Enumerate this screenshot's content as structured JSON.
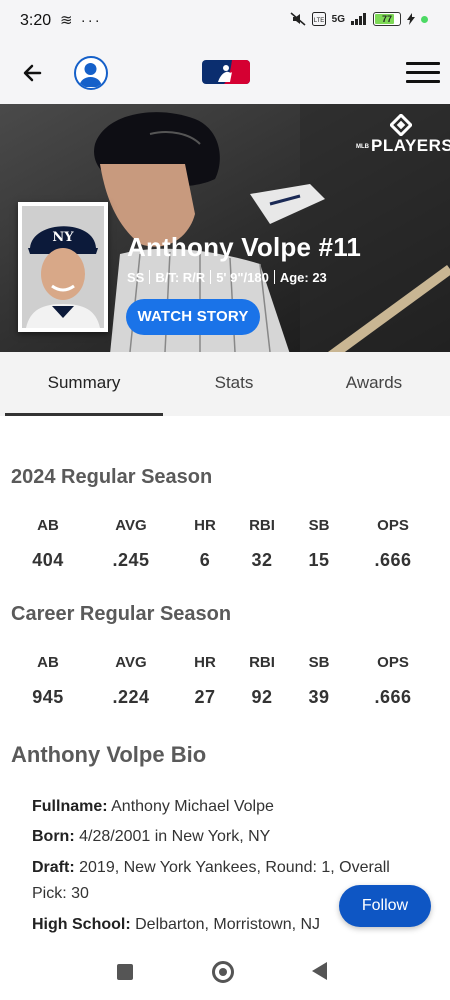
{
  "status_bar": {
    "time": "3:20",
    "left_icons": "≋ ···",
    "network": "5G",
    "battery": "77",
    "battery_color": "#7ed957"
  },
  "header": {
    "back_icon": "arrow-left-icon",
    "profile_icon": "user-circle-icon",
    "logo": "mlb-logo",
    "menu_icon": "hamburger-menu-icon"
  },
  "hero": {
    "players_brand_small": "MLB",
    "players_brand": "PLAYERS",
    "name": "Anthony Volpe #11",
    "position": "SS",
    "bats_throws": "B/T: R/R",
    "height_weight": "5' 9\"/180",
    "age": "Age: 23",
    "watch_button": "WATCH STORY",
    "accent": "#1a73e8"
  },
  "tabs": [
    {
      "label": "Summary",
      "active": true
    },
    {
      "label": "Stats",
      "active": false
    },
    {
      "label": "Awards",
      "active": false
    }
  ],
  "season_2024": {
    "title": "2024 Regular Season",
    "headers": [
      "AB",
      "AVG",
      "HR",
      "RBI",
      "SB",
      "OPS"
    ],
    "values": [
      "404",
      ".245",
      "6",
      "32",
      "15",
      ".666"
    ]
  },
  "career": {
    "title": "Career Regular Season",
    "headers": [
      "AB",
      "AVG",
      "HR",
      "RBI",
      "SB",
      "OPS"
    ],
    "values": [
      "945",
      ".224",
      "27",
      "92",
      "39",
      ".666"
    ]
  },
  "bio": {
    "title": "Anthony Volpe Bio",
    "fullname_label": "Fullname:",
    "fullname": "Anthony Michael Volpe",
    "born_label": "Born:",
    "born": "4/28/2001 in New York, NY",
    "draft_label": "Draft:",
    "draft": "2019, New York Yankees, Round: 1, Overall Pick: 30",
    "high_school_label": "High School:",
    "high_school": "Delbarton, Morristown, NJ"
  },
  "follow_button": "Follow",
  "nav": {
    "recents_icon": "square-icon",
    "home_icon": "circle-home-icon",
    "back_icon": "triangle-back-icon"
  }
}
